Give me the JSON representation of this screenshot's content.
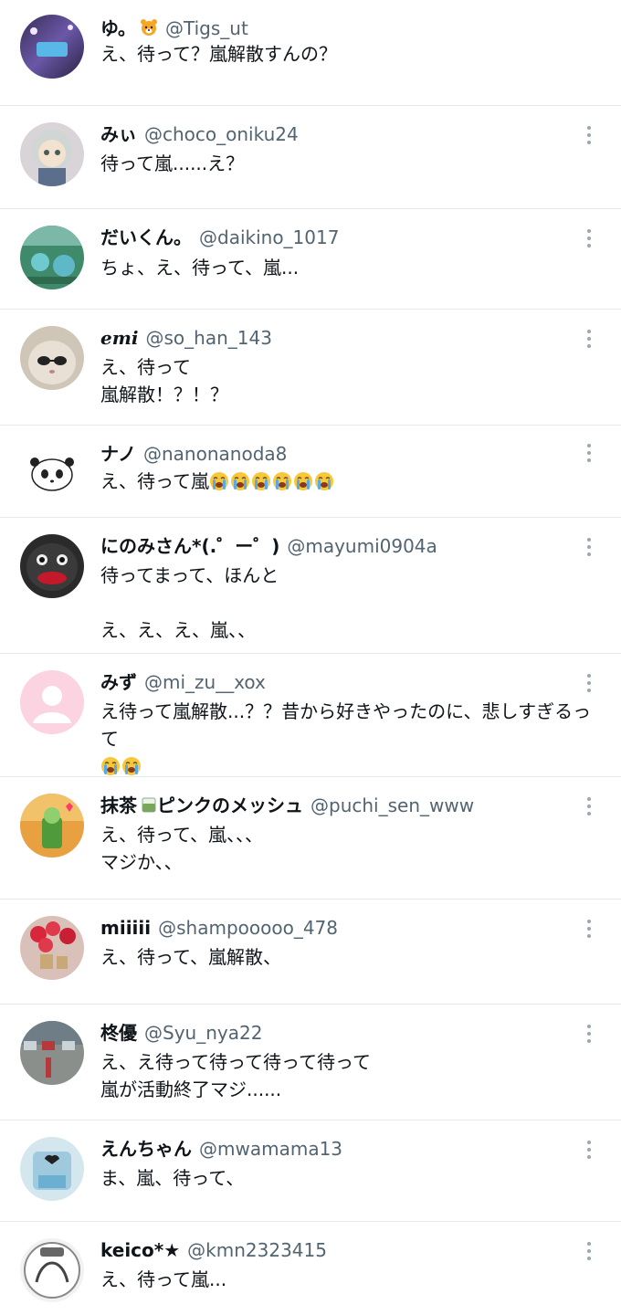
{
  "tweets": [
    {
      "name": "ゆ。",
      "name_emoji": "tiger-face",
      "handle": "@Tigs_ut",
      "text": "え、待って？嵐解散すんの？",
      "more": false
    },
    {
      "name": "みぃ",
      "handle": "@choco_oniku24",
      "text": "待って嵐......え？",
      "more": true
    },
    {
      "name": "だいくん。",
      "handle": "@daikino_1017",
      "text": "ちょ、え、待って、嵐...",
      "more": true
    },
    {
      "name": "emi",
      "handle": "@so_han_143",
      "text": "え、待って\n嵐解散！？！？",
      "more": true
    },
    {
      "name": "ナノ",
      "handle": "@nanonanoda8",
      "text": "え、待って嵐",
      "cry_count": 6,
      "more": true
    },
    {
      "name": "にのみさん*(.゜ー゜)",
      "handle": "@mayumi0904a",
      "text": "待ってまって、ほんと\n\nえ、え、え、嵐、、",
      "more": true
    },
    {
      "name": "みず",
      "handle": "@mi_zu__xox",
      "text": "え待って嵐解散...？？昔から好きやったのに、悲しすぎるって",
      "cry_count": 2,
      "more": true
    },
    {
      "name": "抹茶",
      "name_emoji": "matcha",
      "name_suffix": "ピンクのメッシュ",
      "handle": "@puchi_sen_www",
      "text": "え、待って、嵐、、、\nマジか、、",
      "more": true
    },
    {
      "name": "miiiii",
      "handle": "@shampooooo_478",
      "text": "え、待って、嵐解散、",
      "more": true
    },
    {
      "name": "柊優",
      "handle": "@Syu_nya22",
      "text": "え、え待って待って待って待って\n嵐が活動終了マジ......",
      "more": true
    },
    {
      "name": "えんちゃん",
      "handle": "@mwamama13",
      "text": "ま、嵐、待って、",
      "more": true
    },
    {
      "name": "keico*★",
      "handle": "@kmn2323415",
      "text": "え、待って嵐...",
      "more": true
    }
  ],
  "colors": {
    "name": "#0f1419",
    "handle": "#536471",
    "divider": "#e6e9ec"
  }
}
